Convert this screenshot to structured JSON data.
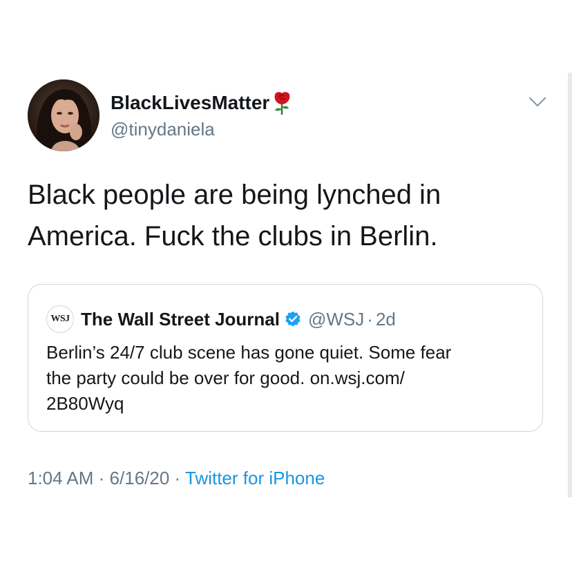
{
  "tweet": {
    "display_name": "BlackLivesMatter",
    "name_emoji": "rose-icon",
    "handle": "@tinydaniela",
    "text_lines": [
      "Black people are being lynched in",
      "America. Fuck the clubs in Berlin."
    ],
    "time": "1:04 AM",
    "date": "6/16/20",
    "separator": "·",
    "source": "Twitter for iPhone"
  },
  "quoted_tweet": {
    "logo_text": "WSJ",
    "name": "The Wall Street Journal",
    "verified": true,
    "handle": "@WSJ",
    "separator": "·",
    "time": "2d",
    "text_lines": [
      "Berlin’s 24/7 club scene has gone quiet. Some fear",
      "the party could be over for good. on.wsj.com/",
      "2B80Wyq"
    ]
  },
  "colors": {
    "primary_text": "#14171a",
    "secondary_text": "#657786",
    "link": "#1b95e0",
    "verified": "#1da1f2",
    "border": "#ccd6dd"
  }
}
